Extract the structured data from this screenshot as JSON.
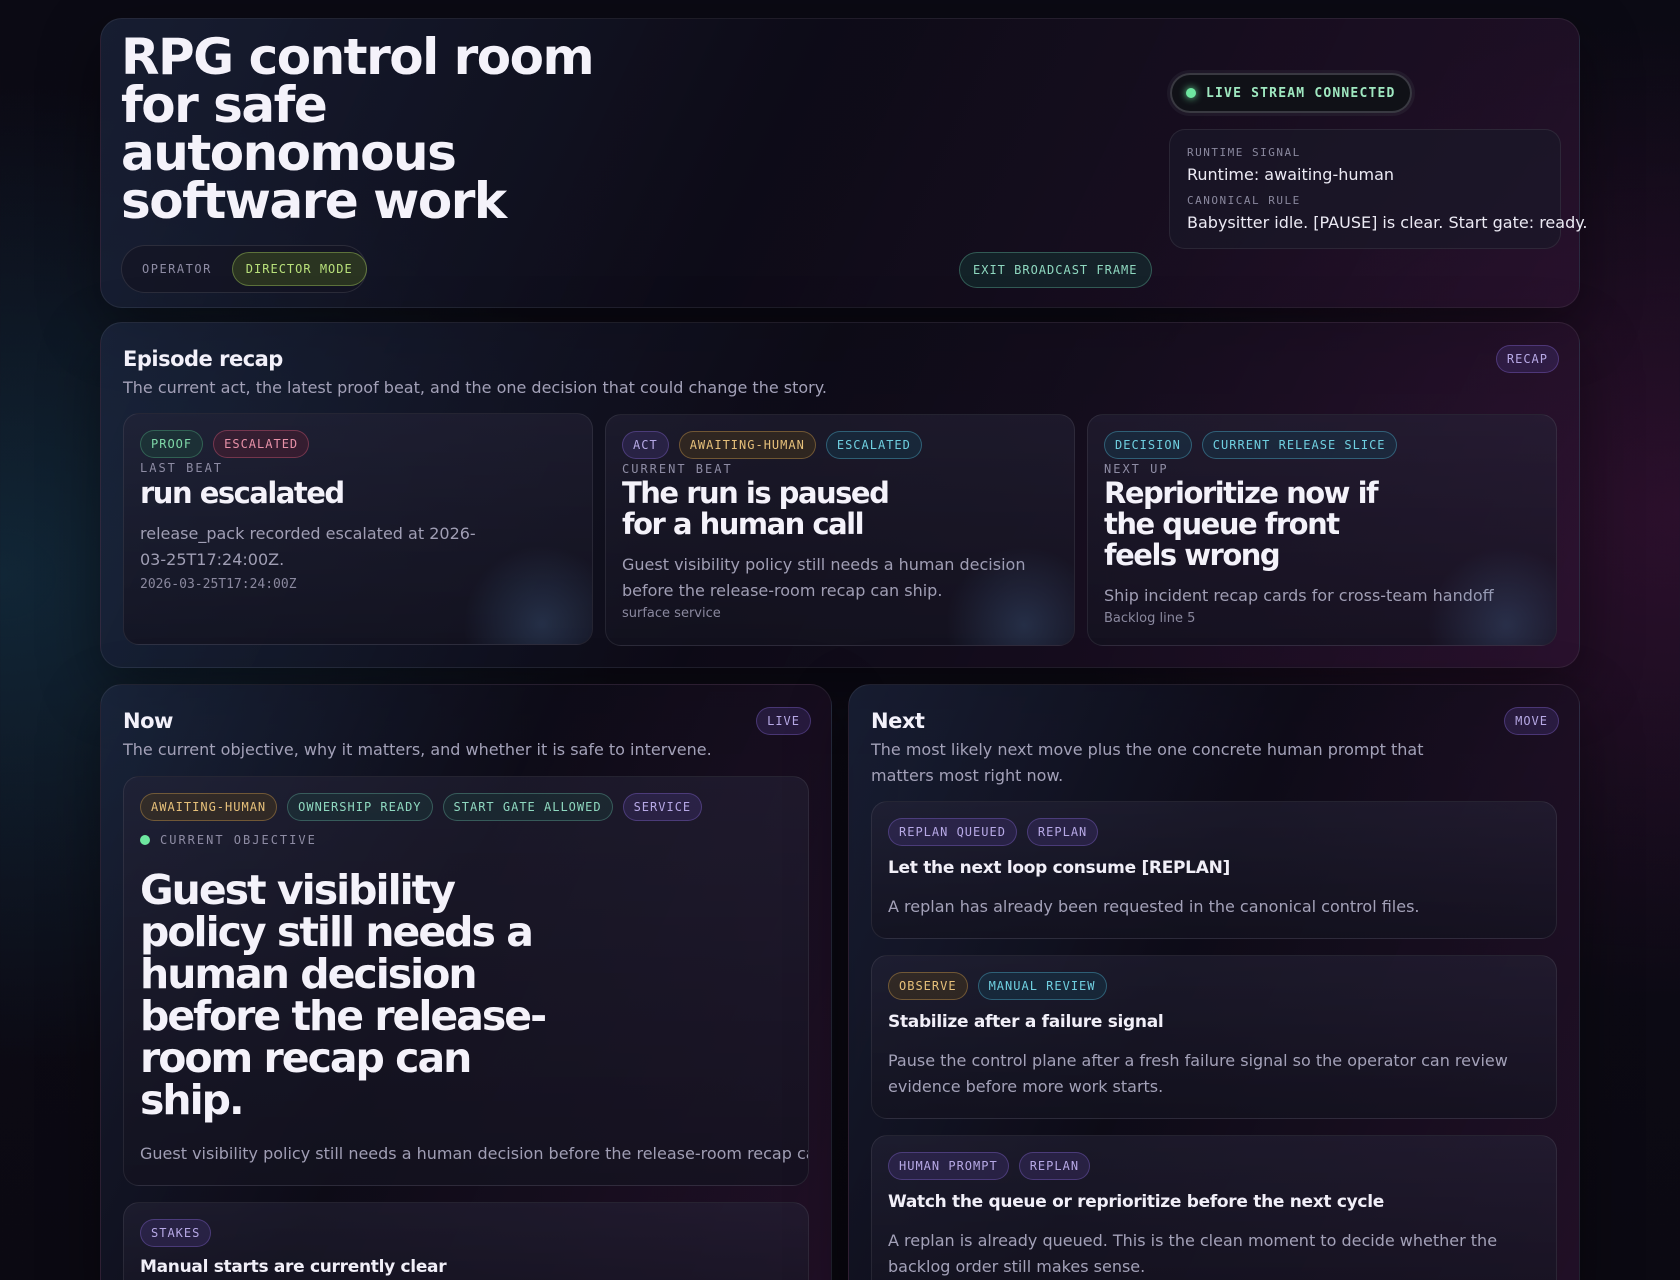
{
  "hero": {
    "title_lines": [
      "RPG control room",
      "for safe",
      "autonomous",
      "software work"
    ],
    "operator_label": "OPERATOR",
    "mode_label": "DIRECTOR MODE",
    "exit_label": "EXIT BROADCAST FRAME",
    "live_label": "LIVE STREAM CONNECTED",
    "signal": {
      "runtime_overline": "RUNTIME SIGNAL",
      "runtime_value": "Runtime: awaiting-human",
      "rule_overline": "CANONICAL RULE",
      "rule_value": "Babysitter idle. [PAUSE] is clear. Start gate: ready."
    }
  },
  "recap": {
    "title": "Episode recap",
    "subtitle": "The current act, the latest proof beat, and the one decision that could change the story.",
    "tag": "RECAP",
    "cards": [
      {
        "chips": [
          "PROOF",
          "ESCALATED"
        ],
        "overline": "LAST BEAT",
        "headline": [
          "run escalated"
        ],
        "body": "release_pack recorded escalated at 2026-03-25T17:24:00Z.",
        "footnote": "2026-03-25T17:24:00Z"
      },
      {
        "chips": [
          "ACT",
          "AWAITING-HUMAN",
          "ESCALATED"
        ],
        "overline": "CURRENT BEAT",
        "headline": [
          "The run is paused",
          "for a human call"
        ],
        "body": "Guest visibility policy still needs a human decision before the release-room recap can ship.",
        "footnote": "surface service"
      },
      {
        "chips": [
          "DECISION",
          "CURRENT RELEASE SLICE"
        ],
        "overline": "NEXT UP",
        "headline": [
          "Reprioritize now if",
          "the queue front",
          "feels wrong"
        ],
        "body": "Ship incident recap cards for cross-team handoff",
        "footnote": "Backlog line 5"
      }
    ]
  },
  "now": {
    "title": "Now",
    "subtitle": "The current objective, why it matters, and whether it is safe to intervene.",
    "tag": "LIVE",
    "objective": {
      "chips": [
        "AWAITING-HUMAN",
        "OWNERSHIP READY",
        "START GATE ALLOWED",
        "SERVICE"
      ],
      "overline": "CURRENT OBJECTIVE",
      "headline": [
        "Guest visibility",
        "policy still needs a",
        "human decision",
        "before the release-",
        "room recap can",
        "ship."
      ],
      "body": "Guest visibility policy still needs a human decision before the release-room recap can ship."
    },
    "stakes": {
      "chip": "STAKES",
      "title": "Manual starts are currently clear"
    }
  },
  "next": {
    "title": "Next",
    "subtitle": "The most likely next move plus the one concrete human prompt that matters most right now.",
    "tag": "MOVE",
    "items": [
      {
        "chips": [
          "REPLAN QUEUED",
          "REPLAN"
        ],
        "title": "Let the next loop consume [REPLAN]",
        "body": "A replan has already been requested in the canonical control files."
      },
      {
        "chips": [
          "OBSERVE",
          "MANUAL REVIEW"
        ],
        "title": "Stabilize after a failure signal",
        "body": "Pause the control plane after a fresh failure signal so the operator can review evidence before more work starts."
      },
      {
        "chips": [
          "HUMAN PROMPT",
          "REPLAN"
        ],
        "title": "Watch the queue or reprioritize before the next cycle",
        "body": "A replan is already queued. This is the clean moment to decide whether the backlog order still makes sense."
      }
    ]
  },
  "colors": {
    "accent_green": "#7fd8a8",
    "live_dot": "#6ee7a0",
    "accent_purple": "#b7a9e6",
    "accent_red": "#e891a8",
    "accent_amber": "#e6c07a",
    "accent_cyan": "#6fcfe0"
  }
}
